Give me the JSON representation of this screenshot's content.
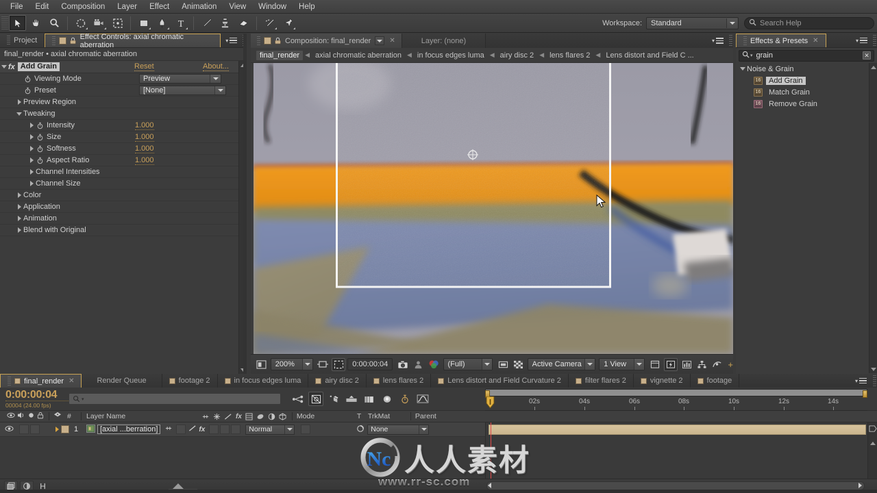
{
  "app": {
    "menu_items": [
      "File",
      "Edit",
      "Composition",
      "Layer",
      "Effect",
      "Animation",
      "View",
      "Window",
      "Help"
    ],
    "workspace_label": "Workspace:",
    "workspace_value": "Standard",
    "help_placeholder": "Search Help",
    "accent_gold": "#c9a05a",
    "panel_bg": "#3c3c3c"
  },
  "toolbar": {
    "tools": [
      {
        "name": "selection-tool",
        "selected": true
      },
      {
        "name": "hand-tool",
        "selected": false
      },
      {
        "name": "zoom-tool",
        "selected": false
      },
      {
        "name": "rotation-tool",
        "selected": false
      },
      {
        "name": "camera-tool",
        "selected": false
      },
      {
        "name": "pan-behind-tool",
        "selected": false
      },
      {
        "name": "shape-tool",
        "selected": false
      },
      {
        "name": "pen-tool",
        "selected": false
      },
      {
        "name": "type-tool",
        "selected": false
      },
      {
        "name": "brush-tool",
        "selected": false
      },
      {
        "name": "clone-stamp-tool",
        "selected": false
      },
      {
        "name": "eraser-tool",
        "selected": false
      },
      {
        "name": "roto-brush-tool",
        "selected": false
      },
      {
        "name": "puppet-pin-tool",
        "selected": false
      }
    ]
  },
  "effect_controls": {
    "tabs": [
      {
        "label": "Project",
        "active": false
      },
      {
        "label": "Effect Controls: axial chromatic aberration",
        "active": true
      }
    ],
    "path": "final_render • axial chromatic aberration",
    "effect_name": "Add Grain",
    "reset_label": "Reset",
    "about_label": "About...",
    "rows": [
      {
        "label": "Viewing Mode",
        "type": "dropdown",
        "value": "Preview",
        "indent": 1,
        "stopwatch": true
      },
      {
        "label": "Preset",
        "type": "dropdown",
        "value": "[None]",
        "indent": 1,
        "stopwatch": true
      },
      {
        "label": "Preview Region",
        "type": "group",
        "indent": 1,
        "expanded": false
      },
      {
        "label": "Tweaking",
        "type": "group",
        "indent": 1,
        "expanded": true
      },
      {
        "label": "Intensity",
        "type": "number",
        "value": "1.000",
        "indent": 2,
        "stopwatch": true,
        "expandable": true
      },
      {
        "label": "Size",
        "type": "number",
        "value": "1.000",
        "indent": 2,
        "stopwatch": true,
        "expandable": true
      },
      {
        "label": "Softness",
        "type": "number",
        "value": "1.000",
        "indent": 2,
        "stopwatch": true,
        "expandable": true
      },
      {
        "label": "Aspect Ratio",
        "type": "number",
        "value": "1.000",
        "indent": 2,
        "stopwatch": true,
        "expandable": true
      },
      {
        "label": "Channel Intensities",
        "type": "group",
        "indent": 2,
        "expanded": false
      },
      {
        "label": "Channel Size",
        "type": "group",
        "indent": 2,
        "expanded": false
      },
      {
        "label": "Color",
        "type": "group",
        "indent": 1,
        "expanded": false
      },
      {
        "label": "Application",
        "type": "group",
        "indent": 1,
        "expanded": false
      },
      {
        "label": "Animation",
        "type": "group",
        "indent": 1,
        "expanded": false
      },
      {
        "label": "Blend with Original",
        "type": "group",
        "indent": 1,
        "expanded": false
      }
    ]
  },
  "viewer": {
    "tab_composition": "Composition: final_render",
    "tab_layer": "Layer: (none)",
    "breadcrumb": [
      {
        "label": "final_render",
        "active": true
      },
      {
        "label": "axial chromatic aberration",
        "active": false
      },
      {
        "label": "in focus edges luma",
        "active": false
      },
      {
        "label": "airy disc 2",
        "active": false
      },
      {
        "label": "lens flares 2",
        "active": false
      },
      {
        "label": "Lens distort and Field C ...",
        "active": false
      }
    ],
    "footer": {
      "zoom": "200%",
      "timecode": "0:00:00:04",
      "resolution": "(Full)",
      "camera": "Active Camera",
      "views": "1 View"
    }
  },
  "effects_presets": {
    "title": "Effects & Presets",
    "search_value": "grain",
    "groups": [
      {
        "label": "Noise & Grain",
        "expanded": true,
        "items": [
          {
            "label": "Add Grain",
            "selected": true,
            "icon": "16bpc-icon"
          },
          {
            "label": "Match Grain",
            "selected": false,
            "icon": "16bpc-icon"
          },
          {
            "label": "Remove Grain",
            "selected": false,
            "icon": "16bpc-icon"
          }
        ]
      }
    ]
  },
  "timeline": {
    "tabs": [
      {
        "label": "final_render",
        "active": true,
        "swatch": true,
        "closable": true
      },
      {
        "label": "Render Queue",
        "active": false,
        "swatch": false
      },
      {
        "label": "footage 2",
        "active": false,
        "swatch": true
      },
      {
        "label": "in focus edges luma",
        "active": false,
        "swatch": true
      },
      {
        "label": "airy disc 2",
        "active": false,
        "swatch": true
      },
      {
        "label": "lens flares 2",
        "active": false,
        "swatch": true
      },
      {
        "label": "Lens distort and Field Curvature 2",
        "active": false,
        "swatch": true
      },
      {
        "label": "filter flares 2",
        "active": false,
        "swatch": true
      },
      {
        "label": "vignette 2",
        "active": false,
        "swatch": true
      },
      {
        "label": "footage",
        "active": false,
        "swatch": true
      }
    ],
    "current_time": "0:00:00:04",
    "frame_info": "00004 (24.00 fps)",
    "search_placeholder": "",
    "columns": [
      "#",
      "Layer Name",
      "Mode",
      "T",
      "TrkMat",
      "Parent"
    ],
    "ruler_ticks": [
      "02s",
      "04s",
      "06s",
      "08s",
      "10s",
      "12s",
      "14s"
    ],
    "layers": [
      {
        "index": "1",
        "name": "[axial ...berration]",
        "mode": "Normal",
        "parent": "None"
      }
    ]
  },
  "watermark": {
    "logo_text": "人人素材",
    "url": "www.rr-sc.com"
  }
}
